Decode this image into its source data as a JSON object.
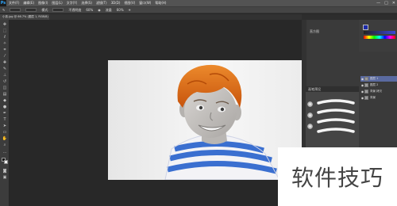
{
  "menubar": {
    "logo": "Ps",
    "items": [
      "文件(F)",
      "编辑(E)",
      "图像(I)",
      "图层(L)",
      "文字(Y)",
      "选择(S)",
      "滤镜(T)",
      "3D(D)",
      "视图(V)",
      "窗口(W)",
      "帮助(H)"
    ],
    "window_controls": [
      "—",
      "□",
      "✕"
    ]
  },
  "options": {
    "mode_label": "模式",
    "opacity_label": "不透明度",
    "opacity_value": "60%",
    "flow_label": "流量",
    "flow_value": "60%"
  },
  "document": {
    "tab_label": "小孩.jpg @ 66.7% (图层 1, RGB/8)"
  },
  "panels": {
    "history_label": "直方图",
    "brush_tab": "画笔预设",
    "color": {
      "fg": "#1c2aa8"
    },
    "layers": [
      {
        "name": "图层 1"
      },
      {
        "name": "图层 2"
      },
      {
        "name": "背景 拷贝"
      },
      {
        "name": "背景"
      }
    ]
  },
  "colors": {
    "hair": "#e06a14",
    "shirt_blue": "#3a6fd0",
    "canvas_bg": "#f2f2f2"
  },
  "watermark": {
    "text": "软件技巧"
  }
}
